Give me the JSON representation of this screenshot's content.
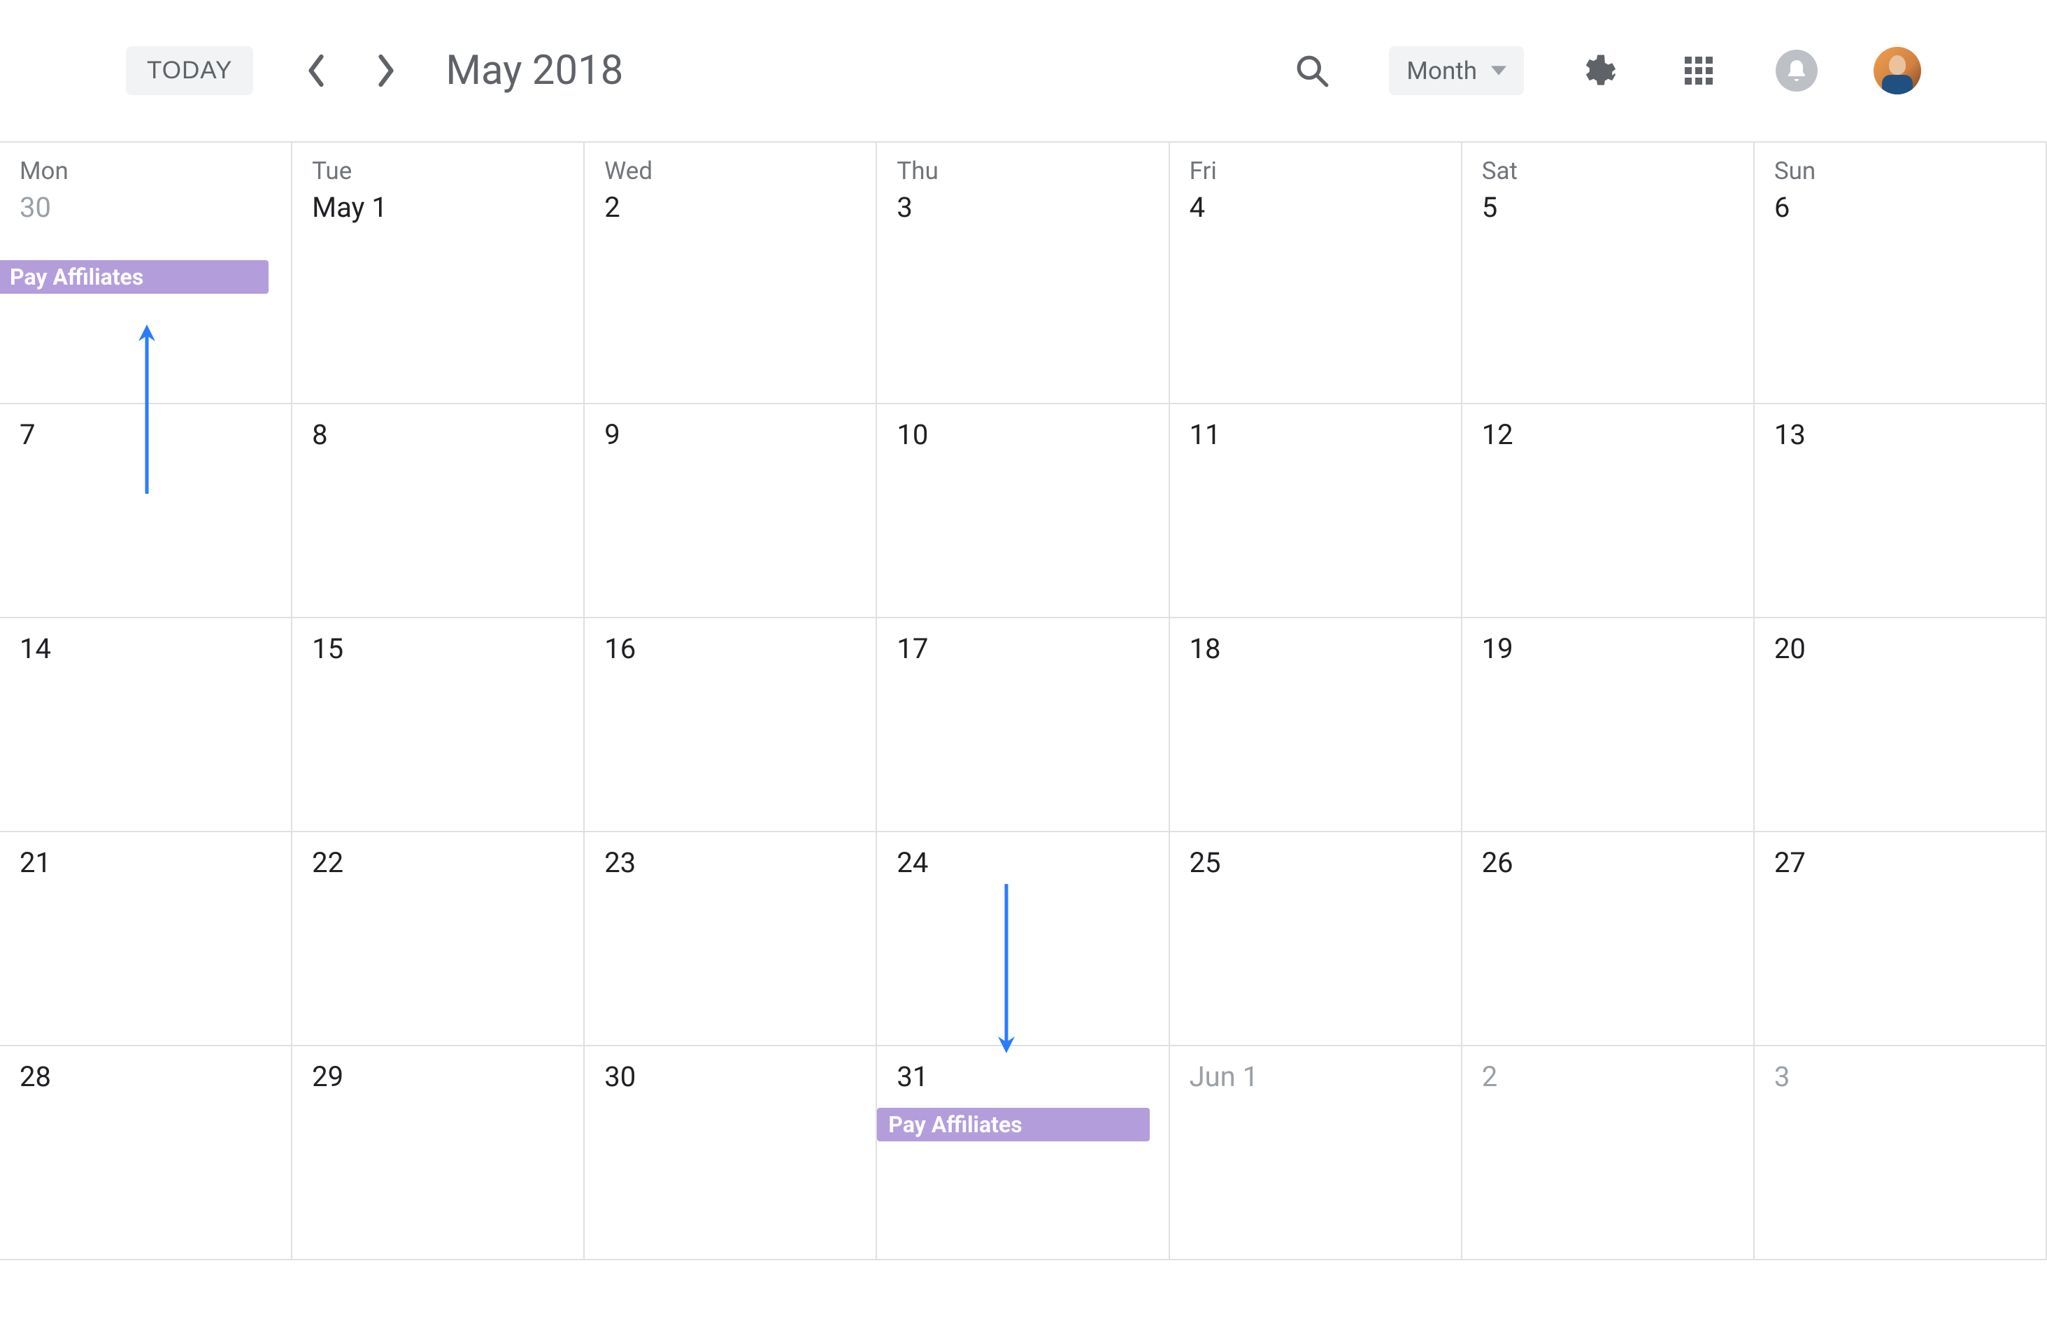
{
  "header": {
    "today_label": "TODAY",
    "title": "May 2018",
    "view_label": "Month"
  },
  "days_header": [
    "Mon",
    "Tue",
    "Wed",
    "Thu",
    "Fri",
    "Sat",
    "Sun"
  ],
  "weeks": [
    [
      {
        "num": "30",
        "muted": true,
        "label": "May 1_prev"
      },
      {
        "num": "May 1",
        "muted": false
      },
      {
        "num": "2",
        "muted": false
      },
      {
        "num": "3",
        "muted": false
      },
      {
        "num": "4",
        "muted": false
      },
      {
        "num": "5",
        "muted": false
      },
      {
        "num": "6",
        "muted": false
      }
    ],
    [
      {
        "num": "7"
      },
      {
        "num": "8"
      },
      {
        "num": "9"
      },
      {
        "num": "10"
      },
      {
        "num": "11"
      },
      {
        "num": "12"
      },
      {
        "num": "13"
      }
    ],
    [
      {
        "num": "14"
      },
      {
        "num": "15"
      },
      {
        "num": "16"
      },
      {
        "num": "17"
      },
      {
        "num": "18"
      },
      {
        "num": "19"
      },
      {
        "num": "20"
      }
    ],
    [
      {
        "num": "21"
      },
      {
        "num": "22"
      },
      {
        "num": "23"
      },
      {
        "num": "24"
      },
      {
        "num": "25"
      },
      {
        "num": "26"
      },
      {
        "num": "27"
      }
    ],
    [
      {
        "num": "28"
      },
      {
        "num": "29"
      },
      {
        "num": "30"
      },
      {
        "num": "31"
      },
      {
        "num": "Jun 1",
        "muted": true
      },
      {
        "num": "2",
        "muted": true
      },
      {
        "num": "3",
        "muted": true
      }
    ]
  ],
  "events": {
    "e1": "Pay Affiliates",
    "e2": "Pay Affiliates"
  },
  "colors": {
    "event_bg": "#b39ddb",
    "annotation": "#2a7cff"
  }
}
